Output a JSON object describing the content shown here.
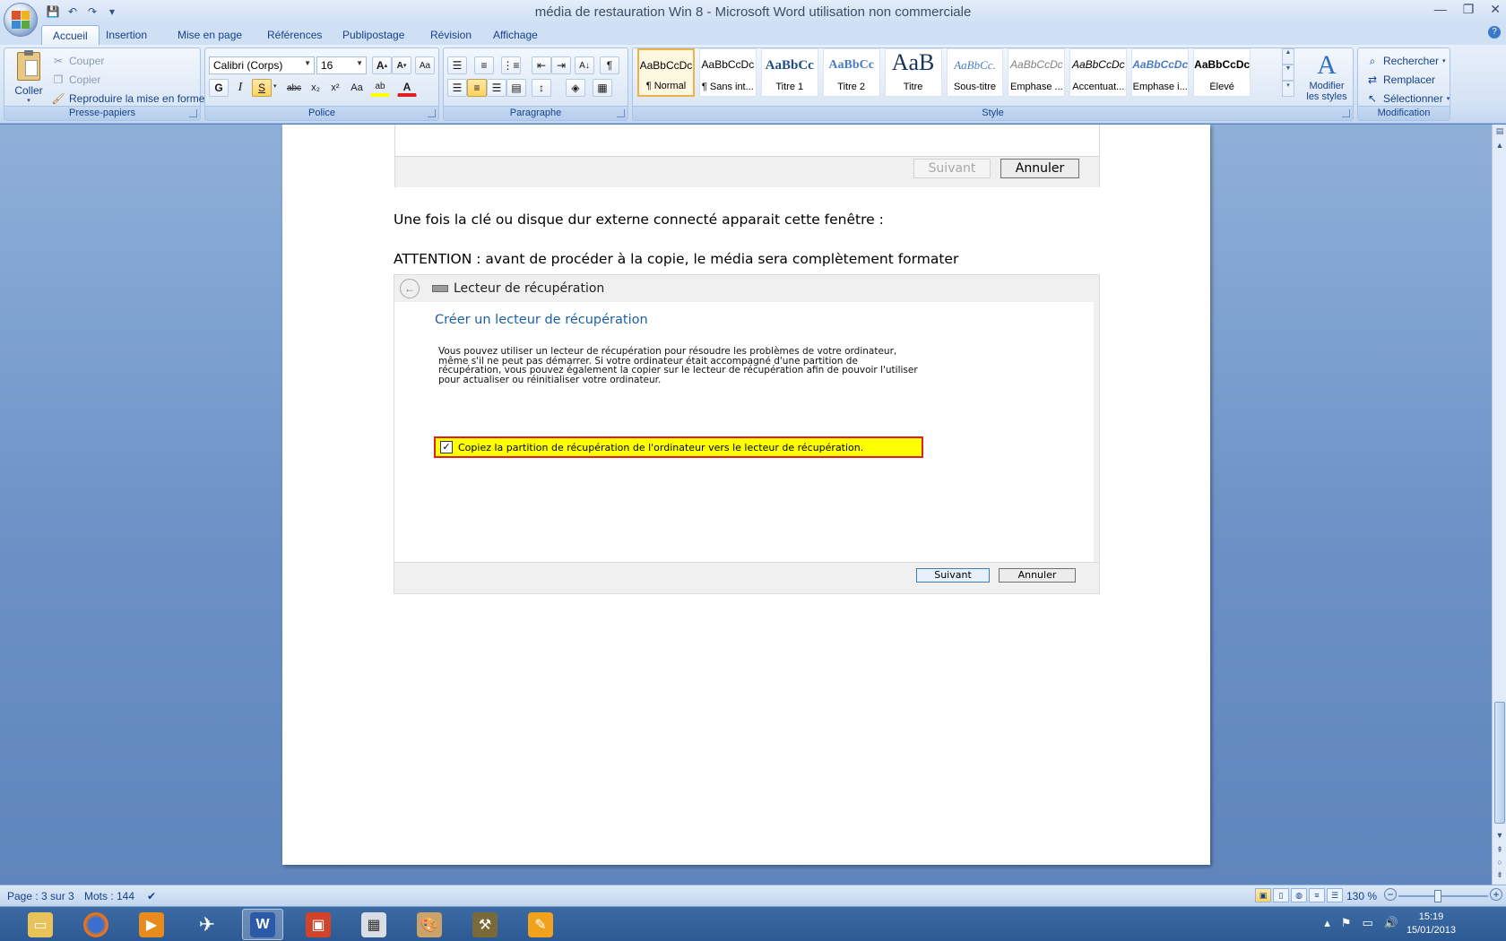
{
  "window": {
    "title": "média de restauration Win 8 - Microsoft Word utilisation non commerciale",
    "minimize": "—",
    "maximize": "❐",
    "close": "✕"
  },
  "qat": {
    "save": "💾",
    "undo": "↶",
    "redo": "↷",
    "customize": "▾"
  },
  "tabs": [
    {
      "label": "Accueil"
    },
    {
      "label": "Insertion"
    },
    {
      "label": "Mise en page"
    },
    {
      "label": "Références"
    },
    {
      "label": "Publipostage"
    },
    {
      "label": "Révision"
    },
    {
      "label": "Affichage"
    }
  ],
  "help": "?",
  "clipboard": {
    "paste": "Coller",
    "cut": "Couper",
    "copy": "Copier",
    "format_painter": "Reproduire la mise en forme",
    "label": "Presse-papiers"
  },
  "font": {
    "name": "Calibri (Corps)",
    "size": "16",
    "grow": "A",
    "shrink": "A",
    "clear": "Aa",
    "bold": "G",
    "italic": "I",
    "underline": "S",
    "strike": "abc",
    "subscript": "x₂",
    "superscript": "x²",
    "case": "Aa",
    "highlight": "ab",
    "color": "A",
    "label": "Police"
  },
  "paragraph": {
    "sort": "A↓",
    "pilcrow": "¶",
    "label": "Paragraphe"
  },
  "styles": {
    "items": [
      {
        "preview": "AaBbCcDc",
        "label": "¶ Normal"
      },
      {
        "preview": "AaBbCcDc",
        "label": "¶ Sans int..."
      },
      {
        "preview": "AaBbCc",
        "label": "Titre 1"
      },
      {
        "preview": "AaBbCc",
        "label": "Titre 2"
      },
      {
        "preview": "AaB",
        "label": "Titre"
      },
      {
        "preview": "AaBbCc.",
        "label": "Sous-titre"
      },
      {
        "preview": "AaBbCcDc",
        "label": "Emphase ..."
      },
      {
        "preview": "AaBbCcDc",
        "label": "Accentuat..."
      },
      {
        "preview": "AaBbCcDc",
        "label": "Emphase i..."
      },
      {
        "preview": "AaBbCcDc",
        "label": "Élevé"
      }
    ],
    "modify_line1": "Modifier",
    "modify_line2": "les styles",
    "label": "Style"
  },
  "editing": {
    "find": "Rechercher",
    "replace": "Remplacer",
    "select": "Sélectionner",
    "label": "Modification"
  },
  "document": {
    "top_dialog": {
      "next": "Suivant",
      "cancel": "Annuler"
    },
    "para1": "Une fois la clé ou disque dur externe connecté apparait cette fenêtre :",
    "para2": "ATTENTION : avant de procéder à la copie, le média sera complètement formater",
    "dialog": {
      "header": "Lecteur de récupération",
      "heading": "Créer un lecteur de récupération",
      "desc_lines": [
        "Vous pouvez utiliser un lecteur de récupération pour résoudre les problèmes de votre ordinateur,",
        "même s'il ne peut pas démarrer. Si votre ordinateur était accompagné d'une partition de",
        "récupération, vous pouvez également la copier sur le lecteur de récupération afin de pouvoir l'utiliser",
        "pour actualiser ou réinitialiser votre ordinateur."
      ],
      "checkbox": "Copiez la partition de récupération de l'ordinateur vers le lecteur de récupération.",
      "check_mark": "✓",
      "next": "Suivant",
      "cancel": "Annuler"
    }
  },
  "status": {
    "page": "Page : 3 sur 3",
    "words": "Mots : 144",
    "zoom": "130 %",
    "zoom_out": "−",
    "zoom_in": "+"
  },
  "taskbar": {
    "time": "15:19",
    "date": "15/01/2013",
    "apps": [
      "file-explorer",
      "firefox",
      "media-player",
      "plane-app",
      "word",
      "presentation",
      "calculator",
      "paint",
      "tool-app",
      "sketch-app"
    ]
  },
  "colors": {
    "accent": "#15428b",
    "highlight_yellow": "#ffff00",
    "highlight_border": "#e02020",
    "dialog_blue": "#1c5fa5"
  }
}
